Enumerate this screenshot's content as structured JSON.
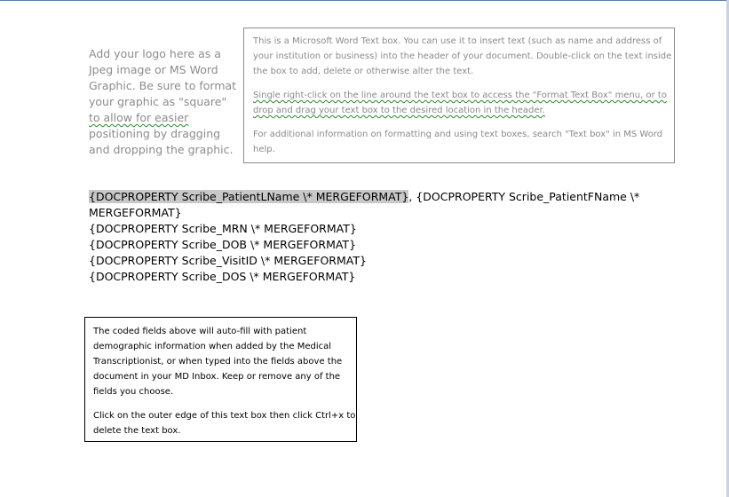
{
  "logo_placeholder": {
    "lines": [
      "Add your logo here as a",
      "Jpeg image or MS Word",
      "Graphic. Be sure to format",
      "your graphic as \"square\"",
      "to allow for easier",
      "positioning by dragging",
      "and dropping the graphic."
    ]
  },
  "header_textbox": {
    "paragraph1_lines": [
      "This is a Microsoft Word Text box. You can use it to insert text (such as name and address of",
      "your institution or business) into the header of your document. Double-click on the text inside",
      "the box to add, delete or otherwise alter the text."
    ],
    "paragraph2_lines": [
      "Single right-click on the line around the text box to access the \"Format Text Box\" menu, or to",
      "drop and drag your text box to the desired location in the header."
    ],
    "paragraph3_lines": [
      "For additional information on formatting and using text boxes, search \"Text box\" in MS Word",
      "help."
    ]
  },
  "fields": {
    "patient_lname": "{DOCPROPERTY Scribe_PatientLName \\* MERGEFORMAT}",
    "separator": ",",
    "patient_fname_part1": "{DOCPROPERTY Scribe_PatientFName \\*",
    "patient_fname_part2": "MERGEFORMAT}",
    "mrn": "{DOCPROPERTY Scribe_MRN \\* MERGEFORMAT}",
    "dob": "{DOCPROPERTY Scribe_DOB \\* MERGEFORMAT}",
    "visit_id": "{DOCPROPERTY Scribe_VisitID \\* MERGEFORMAT}",
    "dos": "{DOCPROPERTY Scribe_DOS \\* MERGEFORMAT}"
  },
  "note_textbox": {
    "paragraph1_lines": [
      "The coded fields above will auto-fill with patient",
      "demographic information when added by the Medical",
      "Transcriptionist, or when typed into the fields above the",
      "document in your MD Inbox. Keep or remove any of the",
      "fields you choose."
    ],
    "paragraph2_lines": [
      "Click on the outer edge of this text box then click Ctrl+x to",
      "delete the text box."
    ]
  }
}
